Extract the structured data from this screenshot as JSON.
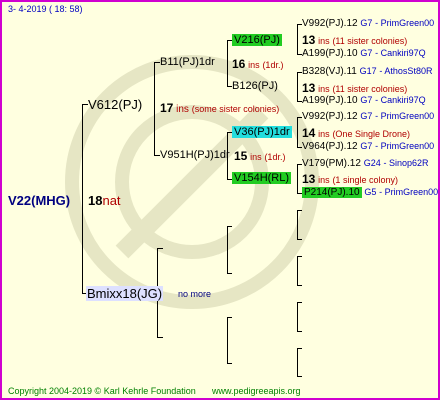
{
  "header": {
    "date": "3-  4-2019  ( 18:  58)"
  },
  "root": {
    "name": "V22(MHG)",
    "number": "18",
    "suffix": "nat"
  },
  "sire": {
    "name": "V612(PJ)",
    "number": "17",
    "ins": "ins",
    "note": "(some sister colonies)"
  },
  "dam": {
    "name": "Bmixx18(JG)",
    "note": "no more"
  },
  "sire_sire": {
    "name": "B11(PJ)1dr",
    "number": "16",
    "ins": "ins",
    "note": "(1dr.)"
  },
  "sire_dam": {
    "name": "V951H(PJ)1dr",
    "number": "15",
    "ins": "ins",
    "note": "(1dr.)"
  },
  "ss_sire": {
    "name": "V216(PJ)"
  },
  "ss_dam": {
    "name": "B126(PJ)"
  },
  "sd_sire": {
    "name": "V36(PJ)1dr"
  },
  "sd_dam": {
    "name": "V154H(RL)"
  },
  "gen5": {
    "r1": {
      "name": "V992(PJ).12",
      "code": "G7",
      "line": "- PrimGreen00"
    },
    "r1mid": {
      "number": "13",
      "ins": "ins",
      "note": "(11 sister colonies)"
    },
    "r2": {
      "name": "A199(PJ).10",
      "code": "G7",
      "line": "- Cankiri97Q"
    },
    "r3": {
      "name": "B328(VJ).11",
      "code": "G17",
      "line": "- AthosSt80R"
    },
    "r3mid": {
      "number": "13",
      "ins": "ins",
      "note": "(11 sister colonies)"
    },
    "r4": {
      "name": "A199(PJ).10",
      "code": "G7",
      "line": "- Cankiri97Q"
    },
    "r5": {
      "name": "V992(PJ).12",
      "code": "G7",
      "line": "- PrimGreen00"
    },
    "r5mid": {
      "number": "14",
      "ins": "ins",
      "note": "(One Single Drone)"
    },
    "r6": {
      "name": "V964(PJ).12",
      "code": "G7",
      "line": "- PrimGreen00"
    },
    "r7": {
      "name": "V179(PM).12",
      "code": "G24",
      "line": "- Sinop62R"
    },
    "r7mid": {
      "number": "13",
      "ins": "ins",
      "note": "(1 single colony)"
    },
    "r8": {
      "name": "P214(PJ).10",
      "code": "G5",
      "line": "- PrimGreen00"
    }
  },
  "footer": {
    "copyright": "Copyright 2004-2019 © Karl Kehrle Foundation",
    "url": "www.pedigreeapis.org"
  },
  "colors": {
    "border": "#d000d0",
    "background": "#ffffe0",
    "green_box": "#22cc22",
    "cyan_box": "#22dddd",
    "footer_text": "#008000"
  }
}
